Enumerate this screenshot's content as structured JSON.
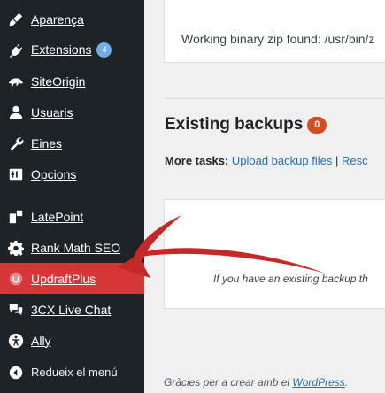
{
  "sidebar": {
    "items": [
      {
        "label": "Aparença",
        "icon": "paintbrush-icon"
      },
      {
        "label": "Extensions",
        "icon": "plugin-icon",
        "badge": "4"
      },
      {
        "label": "SiteOrigin",
        "icon": "siteorigin-icon"
      },
      {
        "label": "Usuaris",
        "icon": "user-icon"
      },
      {
        "label": "Eines",
        "icon": "wrench-icon"
      },
      {
        "label": "Opcions",
        "icon": "settings-icon"
      },
      {
        "label": "LatePoint",
        "icon": "latepoint-icon"
      },
      {
        "label": "Rank Math SEO",
        "icon": "gear-icon"
      },
      {
        "label": "UpdraftPlus",
        "icon": "updraft-icon",
        "active": true
      },
      {
        "label": "3CX Live Chat",
        "icon": "chat-icon"
      },
      {
        "label": "Ally",
        "icon": "accessibility-icon"
      }
    ],
    "collapse_label": "Redueix el menú"
  },
  "main": {
    "status_text": "Working binary zip found: /usr/bin/z",
    "existing_backups_title": "Existing backups",
    "backups_count": "0",
    "more_tasks_label": "More tasks:",
    "upload_link": "Upload backup files",
    "separator": "|",
    "rescan_link": "Resc",
    "empty_message": "If you have an existing backup th"
  },
  "footer": {
    "prefix": "Gràcies per a crear amb el",
    "link": "WordPress",
    "suffix": "."
  },
  "colors": {
    "sidebar_bg": "#1d2327",
    "active_bg": "#d63638",
    "link": "#2271b1",
    "badge_bg": "#72aee6",
    "count_bg": "#d54e21",
    "arrow": "#c62828"
  }
}
